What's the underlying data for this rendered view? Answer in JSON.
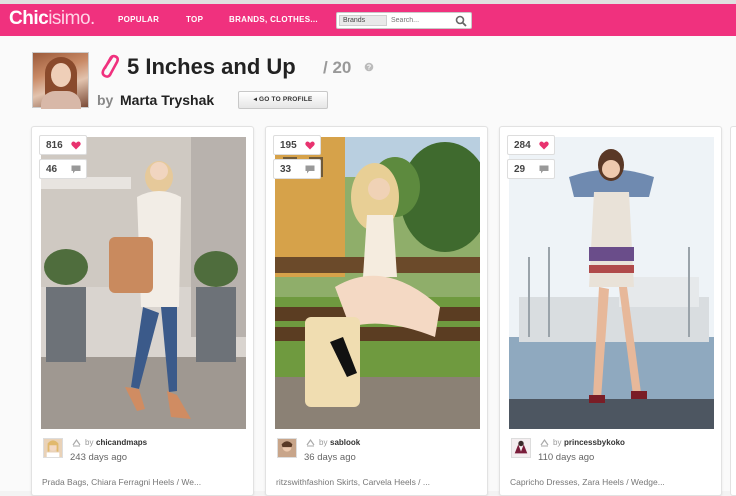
{
  "brand": {
    "logo_bold": "Chic",
    "logo_light": "isimo."
  },
  "nav": {
    "links": [
      "POPULAR",
      "TOP",
      "BRANDS, CLOTHES..."
    ],
    "search_category": "Brands",
    "search_placeholder": "Search..."
  },
  "collection": {
    "title": "5 Inches and Up",
    "count": "/ 20",
    "by": "by",
    "author": "Marta Tryshak",
    "goto_profile": "GO TO PROFILE"
  },
  "cards": [
    {
      "likes": "816",
      "comments": "46",
      "user": "chicandmaps",
      "days": "243 days ago",
      "tags": "Prada Bags, Chiara Ferragni Heels / We..."
    },
    {
      "likes": "195",
      "comments": "33",
      "user": "sablook",
      "days": "36 days ago",
      "tags": "ritzswithfashion Skirts, Carvela Heels / ..."
    },
    {
      "likes": "284",
      "comments": "29",
      "user": "princessbykoko",
      "days": "110 days ago",
      "tags": "Capricho Dresses, Zara Heels / Wedge..."
    }
  ],
  "colors": {
    "brand_pink": "#f0317e",
    "heart": "#e8336f"
  }
}
